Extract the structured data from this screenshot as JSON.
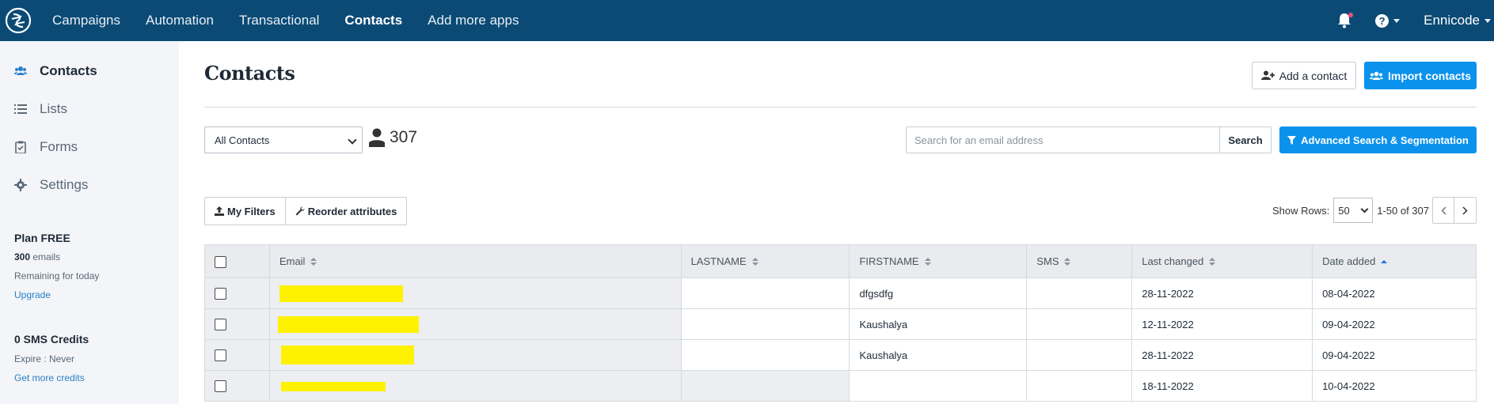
{
  "topbar": {
    "nav": [
      "Campaigns",
      "Automation",
      "Transactional",
      "Contacts",
      "Add more apps"
    ],
    "active_nav": "Contacts",
    "user": "Ennicode",
    "help_glyph": "?",
    "brand_color": "#0b4a75"
  },
  "sidebar": {
    "items": [
      {
        "label": "Contacts",
        "icon": "users-icon",
        "active": true
      },
      {
        "label": "Lists",
        "icon": "list-icon"
      },
      {
        "label": "Forms",
        "icon": "clipboard-check-icon"
      },
      {
        "label": "Settings",
        "icon": "gear-icon"
      }
    ],
    "plan": {
      "title": "Plan FREE",
      "emails_count": "300",
      "emails_label": "emails",
      "remaining": "Remaining for today",
      "upgrade": "Upgrade"
    },
    "sms": {
      "title": "0 SMS Credits",
      "expire": "Expire : Never",
      "more": "Get more credits"
    }
  },
  "main": {
    "title": "Contacts",
    "add_contact": "Add a contact",
    "import_contacts": "Import contacts",
    "filter_select": "All Contacts",
    "contact_count": "307",
    "search_placeholder": "Search for an email address",
    "search_button": "Search",
    "advanced_search": "Advanced Search & Segmentation",
    "my_filters": "My Filters",
    "reorder": "Reorder attributes",
    "show_rows_label": "Show Rows:",
    "rows_value": "50",
    "range": "1-50 of 307",
    "primary_color": "#0b92ec"
  },
  "table": {
    "columns": [
      "Email",
      "LASTNAME",
      "FIRSTNAME",
      "SMS",
      "Last changed",
      "Date added"
    ],
    "rows": [
      {
        "email": "",
        "lastname": "",
        "firstname": "dfgsdfg",
        "sms": "",
        "last_changed": "28-11-2022",
        "date_added": "08-04-2022"
      },
      {
        "email": "",
        "lastname": "",
        "firstname": "Kaushalya",
        "sms": "",
        "last_changed": "12-11-2022",
        "date_added": "09-04-2022"
      },
      {
        "email": "",
        "lastname": "",
        "firstname": "Kaushalya",
        "sms": "",
        "last_changed": "28-11-2022",
        "date_added": "09-04-2022"
      },
      {
        "email": "",
        "lastname": "",
        "firstname": "",
        "sms": "",
        "last_changed": "18-11-2022",
        "date_added": "10-04-2022"
      }
    ]
  }
}
